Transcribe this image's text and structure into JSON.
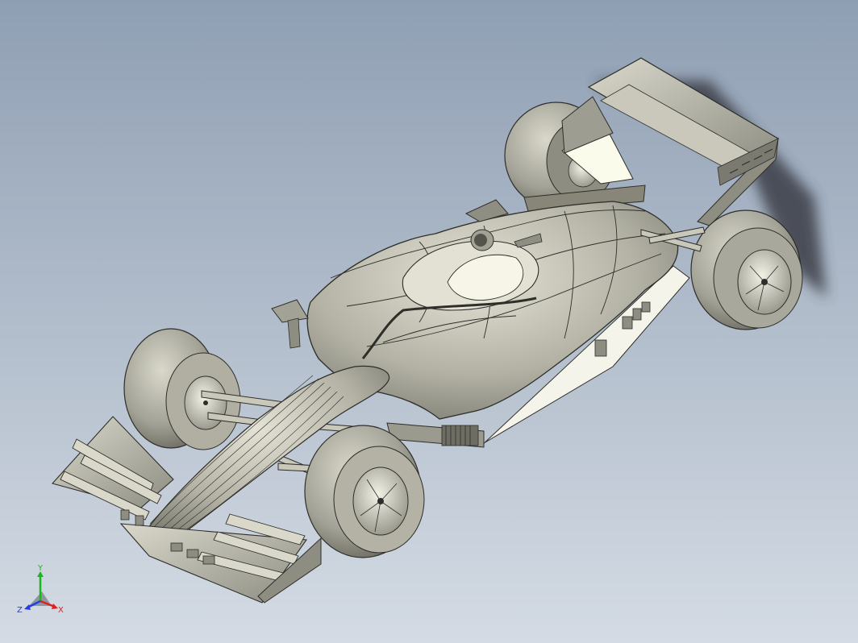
{
  "viewport": {
    "background_top": "#8f9fb3",
    "background_bottom": "#d4dbe4",
    "model_name": "formula-one-race-car"
  },
  "triad": {
    "x_label": "X",
    "y_label": "Y",
    "z_label": "Z",
    "x_color": "#e02020",
    "y_color": "#18b818",
    "z_color": "#2040e0"
  },
  "colors": {
    "body": "#b9b8ab",
    "body_dark": "#6e6d63",
    "tire": "#a9a99c",
    "edge": "#2e2e2a",
    "highlight": "#f2f1df"
  }
}
